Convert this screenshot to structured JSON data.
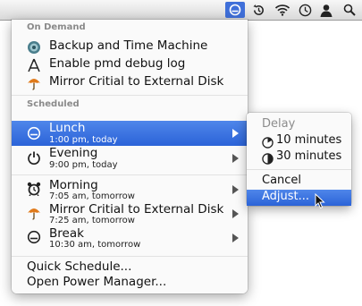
{
  "menubar": {
    "icons": [
      "power-manager-icon",
      "time-machine-icon",
      "wifi-icon",
      "clock-icon",
      "user-icon",
      "spotlight-icon"
    ]
  },
  "menu": {
    "on_demand_label": "On Demand",
    "on_demand": [
      {
        "label": "Backup and Time Machine",
        "icon": "backup-disc-icon"
      },
      {
        "label": "Enable pmd debug log",
        "icon": "compass-icon"
      },
      {
        "label": "Mirror Critial to External Disk",
        "icon": "umbrella-icon"
      }
    ],
    "scheduled_label": "Scheduled",
    "scheduled": [
      {
        "label": "Lunch",
        "sub": "1:00 pm, today",
        "icon": "sleep-icon",
        "highlighted": true
      },
      {
        "label": "Evening",
        "sub": "9:00 pm, today",
        "icon": "power-icon"
      },
      {
        "label": "Morning",
        "sub": "7:05 am, tomorrow",
        "icon": "alarm-clock-icon"
      },
      {
        "label": "Mirror Critial to External Disk",
        "sub": "7:25 am, tomorrow",
        "icon": "umbrella-icon"
      },
      {
        "label": "Break",
        "sub": "10:30 am, tomorrow",
        "icon": "sleep-icon"
      }
    ],
    "quick_schedule": "Quick Schedule...",
    "open_power_manager": "Open Power Manager..."
  },
  "submenu": {
    "heading": "Delay",
    "delay_10": "10 minutes",
    "delay_30": "30 minutes",
    "cancel": "Cancel",
    "adjust": "Adjust..."
  },
  "colors": {
    "highlight": "#3a73e0",
    "section_label": "#8a8a8a"
  }
}
